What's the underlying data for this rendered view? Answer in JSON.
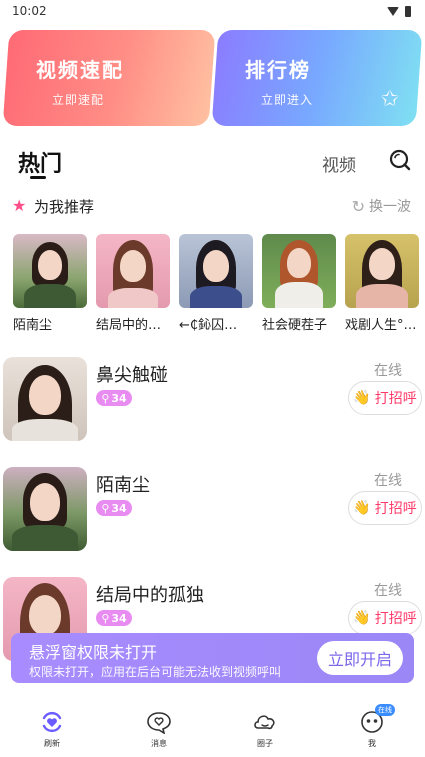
{
  "status_bar": {
    "time": "10:02"
  },
  "banners": {
    "match": {
      "title": "视频速配",
      "subtitle": "立即速配"
    },
    "rank": {
      "title": "排行榜",
      "subtitle": "立即进入"
    }
  },
  "tabs": {
    "hot": "热门",
    "video": "视频"
  },
  "recommend": {
    "title": "为我推荐",
    "refresh": "换一波",
    "items": [
      {
        "name": "陌南尘"
      },
      {
        "name": "结局中的…"
      },
      {
        "name": "←₵鈊囚…"
      },
      {
        "name": "社会硬茬子"
      },
      {
        "name": "戏剧人生°…"
      }
    ]
  },
  "users": [
    {
      "name": "鼻尖触碰",
      "tag": "34",
      "status": "在线",
      "greet": "打招呼"
    },
    {
      "name": "陌南尘",
      "tag": "34",
      "status": "在线",
      "greet": "打招呼"
    },
    {
      "name": "结局中的孤独",
      "tag": "34",
      "status": "在线",
      "greet": "打招呼"
    }
  ],
  "float_banner": {
    "title": "悬浮窗权限未打开",
    "desc": "权限未打开，应用在后台可能无法收到视频呼叫",
    "button": "立即开启"
  },
  "nav": {
    "refresh": "刷新",
    "messages": "消息",
    "circle": "圈子",
    "me": "我",
    "me_badge": "在线"
  },
  "colors": {
    "accent_pink": "#ff3b6a",
    "tag_purple": "#e88cf2",
    "nav_active": "#6a5cff",
    "float_bg": "#a88cff"
  }
}
